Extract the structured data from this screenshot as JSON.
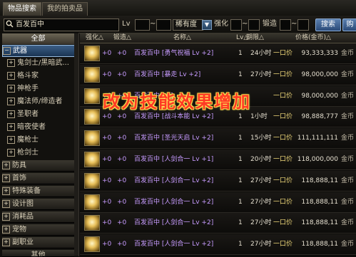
{
  "tabs": [
    {
      "label": "物品搜索"
    },
    {
      "label": "我的拍卖品"
    }
  ],
  "filter": {
    "search_value": "百发百中",
    "lv_label": "Lv",
    "tilde": "~",
    "rarity": "稀有度",
    "enhance_label": "强化",
    "forge_label": "锻造",
    "search_button": "搜索",
    "extra_button": "购"
  },
  "sidebar": {
    "all": "全部",
    "weapon": "武器",
    "sub": [
      "鬼剑士/黑暗武...",
      "格斗家",
      "神枪手",
      "魔法师/缔造者",
      "圣职者",
      "暗夜使者",
      "魔枪士",
      "枪剑士"
    ],
    "cats": [
      "防具",
      "首饰",
      "特殊装备",
      "设计图",
      "消耗品",
      "宠物",
      "副职业",
      "其他"
    ]
  },
  "columns": {
    "enhance": "强化△",
    "forge": "锻造△",
    "name": "名称△",
    "lv": "Lv△",
    "period": "期限△",
    "price": "价格(金币)△"
  },
  "rows": [
    {
      "enh": "+0",
      "forge": "+0",
      "name": "百发百中 [勇气祝福 Lv +2]",
      "lv": "1",
      "period": "24小时",
      "price_label": "一口价",
      "price": "93,333,333",
      "unit": "金币"
    },
    {
      "enh": "+0",
      "forge": "+0",
      "name": "百发百中 [暴走 Lv +2]",
      "lv": "1",
      "period": "27小时",
      "price_label": "一口价",
      "price": "98,000,000",
      "unit": "金币"
    },
    {
      "enh": "+0",
      "forge": "+0",
      "name": "百发百中 [...]",
      "lv": "",
      "period": "",
      "price_label": "一口价",
      "price": "98,000,000",
      "unit": "金币"
    },
    {
      "enh": "+0",
      "forge": "+0",
      "name": "百发百中 [战斗本能 Lv +2]",
      "lv": "1",
      "period": "1小时",
      "price_label": "一口价",
      "price": "98,888,777",
      "unit": "金币"
    },
    {
      "enh": "+0",
      "forge": "+0",
      "name": "百发百中 [圣光天启 Lv +2]",
      "lv": "1",
      "period": "15小时",
      "price_label": "一口价",
      "price": "111,111,111",
      "unit": "金币"
    },
    {
      "enh": "+0",
      "forge": "+0",
      "name": "百发百中 [人剑合一 Lv +1]",
      "lv": "1",
      "period": "20小时",
      "price_label": "一口价",
      "price": "118,000,000",
      "unit": "金币"
    },
    {
      "enh": "+0",
      "forge": "+0",
      "name": "百发百中 [人剑合一 Lv +2]",
      "lv": "1",
      "period": "27小时",
      "price_label": "一口价",
      "price": "118,888,11",
      "unit": "金币"
    },
    {
      "enh": "+0",
      "forge": "+0",
      "name": "百发百中 [人剑合一 Lv +2]",
      "lv": "1",
      "period": "27小时",
      "price_label": "一口价",
      "price": "118,888,11",
      "unit": "金币"
    },
    {
      "enh": "+0",
      "forge": "+0",
      "name": "百发百中 [人剑合一 Lv +2]",
      "lv": "1",
      "period": "27小时",
      "price_label": "一口价",
      "price": "118,888,11",
      "unit": "金币"
    },
    {
      "enh": "+0",
      "forge": "+0",
      "name": "百发百中 [人剑合一 Lv +2]",
      "lv": "1",
      "period": "27小时",
      "price_label": "一口价",
      "price": "118,888,11",
      "unit": "金币"
    }
  ],
  "overlay": "改为技能效果增加"
}
